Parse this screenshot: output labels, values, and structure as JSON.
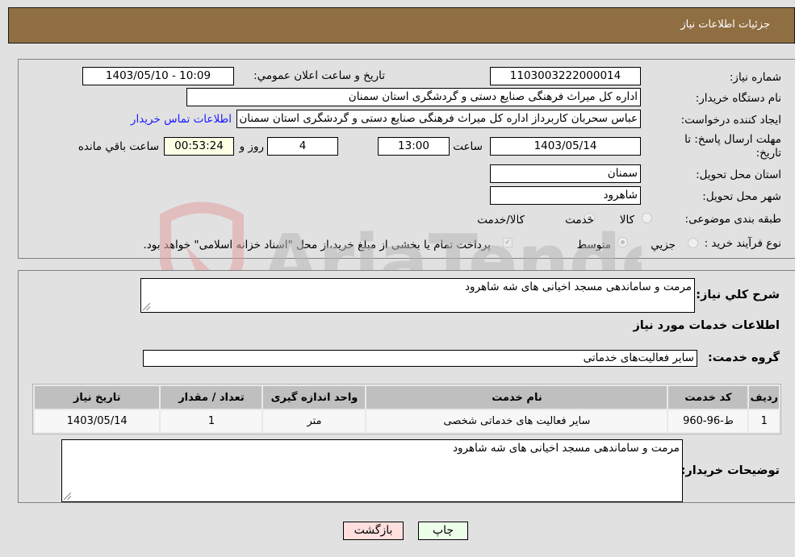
{
  "header": {
    "title": "جزئیات اطلاعات نیاز"
  },
  "form": {
    "need_number": {
      "label": "شماره نیاز:",
      "value": "1103003222000014"
    },
    "announce_datetime": {
      "label": "تاریخ و ساعت اعلان عمومي:",
      "value": "1403/05/10 - 10:09"
    },
    "buyer_org": {
      "label": "نام دستگاه خريدار:",
      "value": "اداره کل میراث فرهنگی  صنایع دستی و گردشگری استان سمنان"
    },
    "requester": {
      "label": "ایجاد کننده درخواست:",
      "value": "عباس سحربان کاربرداز اداره کل میراث فرهنگی  صنایع دستی و گردشگری استان سمنان",
      "contact_link": "اطلاعات تماس خریدار"
    },
    "deadline": {
      "label": "مهلت ارسال پاسخ: تا تاریخ:",
      "date": "1403/05/14",
      "time_label": "ساعت",
      "time": "13:00",
      "days": "4",
      "days_label": "روز و",
      "remaining": "00:53:24",
      "remaining_label": "ساعت باقي مانده"
    },
    "province": {
      "label": "استان محل تحویل:",
      "value": "سمنان"
    },
    "city": {
      "label": "شهر محل تحویل:",
      "value": "شاهرود"
    },
    "category": {
      "label": "طبقه بندی موضوعی:",
      "options": [
        "کالا",
        "خدمت",
        "کالا/خدمت"
      ],
      "selected": "خدمت"
    },
    "purchase_type": {
      "label": "نوع فرآیند خرید :",
      "options": [
        "جزيي",
        "متوسط"
      ],
      "selected": "متوسط",
      "payment_note": "پرداخت تمام یا بخشی از مبلغ خرید،از محل \"اسناد خزانه اسلامی\" خواهد بود.",
      "payment_checked": true
    }
  },
  "details": {
    "summary_label": "شرح کلي نیاز:",
    "summary_value": "مرمت و ساماندهی مسجد اخیانی های شه شاهرود",
    "services_heading": "اطلاعات خدمات مورد نیاز",
    "service_group_label": "گروه خدمت:",
    "service_group_value": "سایر فعالیت‌های خدماتی",
    "table": {
      "headers": [
        "ردیف",
        "کد خدمت",
        "نام خدمت",
        "واحد اندازه گیری",
        "تعداد / مقدار",
        "تاریخ نیاز"
      ],
      "rows": [
        [
          "1",
          "ط-96-960",
          "سایر فعالیت های خدماتی شخصی",
          "متر",
          "1",
          "1403/05/14"
        ]
      ]
    },
    "buyer_notes_label": "توضیحات خریدار:",
    "buyer_notes_value": "مرمت و ساماندهی مسجد اخیانی های شه شاهرود"
  },
  "buttons": {
    "print": "چاپ",
    "back": "بازگشت"
  },
  "watermark": {
    "text": "AriaTender.neT"
  },
  "colors": {
    "header": "#8f6e42",
    "print_bg": "#ecffe9",
    "back_bg": "#ffdede",
    "link": "#1a1aff"
  }
}
